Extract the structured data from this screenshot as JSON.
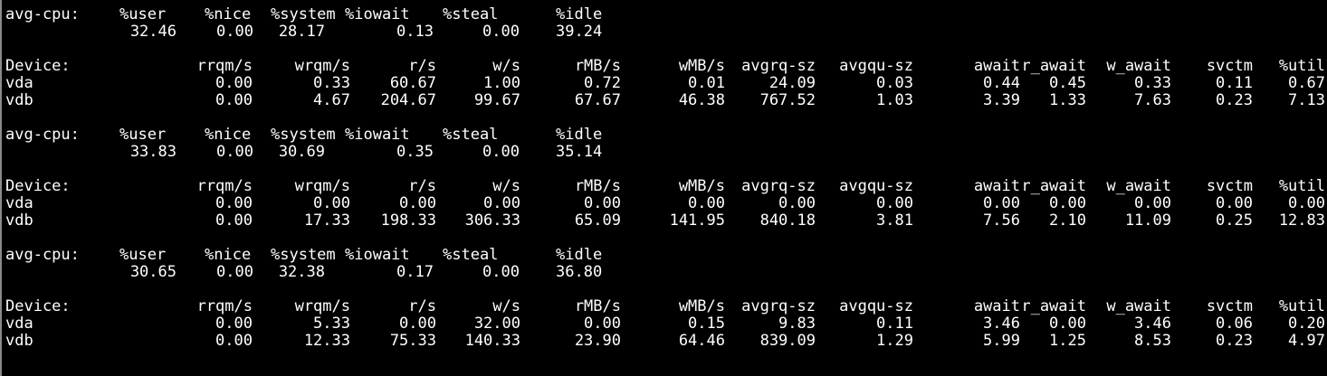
{
  "colors": {
    "background": "#000000",
    "text": "#ffffff"
  },
  "blocks": [
    {
      "cpu_label": "avg-cpu:",
      "cpu_headers": [
        "%user",
        "%nice",
        "%system",
        "%iowait",
        "%steal",
        "%idle"
      ],
      "cpu_values": [
        "32.46",
        "0.00",
        "28.17",
        "0.13",
        "0.00",
        "39.24"
      ],
      "dev_headers": [
        "Device:",
        "rrqm/s",
        "wrqm/s",
        "r/s",
        "w/s",
        "rMB/s",
        "wMB/s",
        "avgrq-sz",
        "avgqu-sz",
        "await",
        "r_await",
        "w_await",
        "svctm",
        "%util"
      ],
      "devices": [
        [
          "vda",
          "0.00",
          "0.33",
          "60.67",
          "1.00",
          "0.72",
          "0.01",
          "24.09",
          "0.03",
          "0.44",
          "0.45",
          "0.33",
          "0.11",
          "0.67"
        ],
        [
          "vdb",
          "0.00",
          "4.67",
          "204.67",
          "99.67",
          "67.67",
          "46.38",
          "767.52",
          "1.03",
          "3.39",
          "1.33",
          "7.63",
          "0.23",
          "7.13"
        ]
      ]
    },
    {
      "cpu_label": "avg-cpu:",
      "cpu_headers": [
        "%user",
        "%nice",
        "%system",
        "%iowait",
        "%steal",
        "%idle"
      ],
      "cpu_values": [
        "33.83",
        "0.00",
        "30.69",
        "0.35",
        "0.00",
        "35.14"
      ],
      "dev_headers": [
        "Device:",
        "rrqm/s",
        "wrqm/s",
        "r/s",
        "w/s",
        "rMB/s",
        "wMB/s",
        "avgrq-sz",
        "avgqu-sz",
        "await",
        "r_await",
        "w_await",
        "svctm",
        "%util"
      ],
      "devices": [
        [
          "vda",
          "0.00",
          "0.00",
          "0.00",
          "0.00",
          "0.00",
          "0.00",
          "0.00",
          "0.00",
          "0.00",
          "0.00",
          "0.00",
          "0.00",
          "0.00"
        ],
        [
          "vdb",
          "0.00",
          "17.33",
          "198.33",
          "306.33",
          "65.09",
          "141.95",
          "840.18",
          "3.81",
          "7.56",
          "2.10",
          "11.09",
          "0.25",
          "12.83"
        ]
      ]
    },
    {
      "cpu_label": "avg-cpu:",
      "cpu_headers": [
        "%user",
        "%nice",
        "%system",
        "%iowait",
        "%steal",
        "%idle"
      ],
      "cpu_values": [
        "30.65",
        "0.00",
        "32.38",
        "0.17",
        "0.00",
        "36.80"
      ],
      "dev_headers": [
        "Device:",
        "rrqm/s",
        "wrqm/s",
        "r/s",
        "w/s",
        "rMB/s",
        "wMB/s",
        "avgrq-sz",
        "avgqu-sz",
        "await",
        "r_await",
        "w_await",
        "svctm",
        "%util"
      ],
      "devices": [
        [
          "vda",
          "0.00",
          "5.33",
          "0.00",
          "32.00",
          "0.00",
          "0.15",
          "9.83",
          "0.11",
          "3.46",
          "0.00",
          "3.46",
          "0.06",
          "0.20"
        ],
        [
          "vdb",
          "0.00",
          "12.33",
          "75.33",
          "140.33",
          "23.90",
          "64.46",
          "839.09",
          "1.29",
          "5.99",
          "1.25",
          "8.53",
          "0.23",
          "4.97"
        ]
      ]
    }
  ]
}
